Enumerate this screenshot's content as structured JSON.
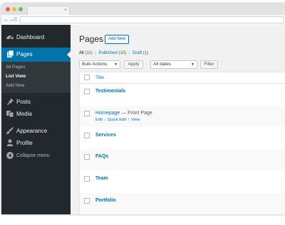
{
  "browser": {
    "tab_close": "×",
    "nav_back": "←",
    "nav_forward": "→",
    "nav_reload": "C"
  },
  "sidebar": {
    "items": [
      {
        "label": "Dashboard",
        "icon": "dashboard-icon"
      },
      {
        "label": "Pages",
        "icon": "pages-icon"
      },
      {
        "label": "Posts",
        "icon": "pin-icon"
      },
      {
        "label": "Media",
        "icon": "media-icon"
      },
      {
        "label": "Appearance",
        "icon": "paintbrush-icon"
      },
      {
        "label": "Profile",
        "icon": "user-icon"
      },
      {
        "label": "Collapse menu",
        "icon": "collapse-icon"
      }
    ],
    "submenu": [
      "All Pages",
      "List View",
      "Add New"
    ]
  },
  "main": {
    "title": "Pages",
    "add_new": "Add New",
    "filters": {
      "all": "All",
      "all_count": "(11)",
      "published": "Published",
      "published_count": "(10)",
      "draft": "Draft",
      "draft_count": "(1)",
      "sep": "|"
    },
    "bulk_actions": "Bulk Actions",
    "apply": "Apply",
    "all_dates": "All dates",
    "filter": "Filter",
    "caret": "▼",
    "column_title": "Title",
    "rows": [
      {
        "title": "Testimonials"
      },
      {
        "title": "Homepage",
        "state": " — Front Page",
        "actions": {
          "edit": "Edit",
          "quick_edit": "Quick Edit",
          "view": "View",
          "sep": "|"
        }
      },
      {
        "title": "Services"
      },
      {
        "title": "FAQs"
      },
      {
        "title": "Team"
      },
      {
        "title": "Portfolio"
      }
    ]
  },
  "colors": {
    "sidebar_bg": "#23282d",
    "accent": "#0073aa",
    "content_bg": "#f1f1f1"
  }
}
